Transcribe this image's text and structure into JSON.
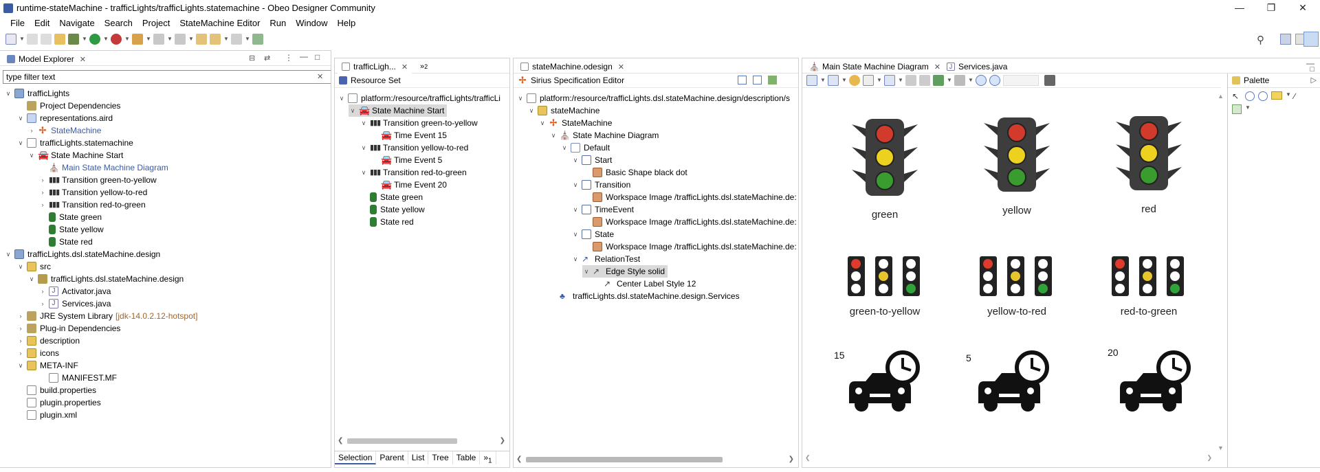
{
  "window": {
    "title": "runtime-stateMachine - trafficLights/trafficLights.statemachine - Obeo Designer Community"
  },
  "menu": [
    "File",
    "Edit",
    "Navigate",
    "Search",
    "Project",
    "StateMachine Editor",
    "Run",
    "Window",
    "Help"
  ],
  "model_explorer": {
    "tab_label": "Model Explorer",
    "filter_placeholder": "type filter text",
    "rows": [
      {
        "label": "trafficLights"
      },
      {
        "label": "Project Dependencies"
      },
      {
        "label": "representations.aird"
      },
      {
        "label": "StateMachine"
      },
      {
        "label": "trafficLights.statemachine"
      },
      {
        "label": "State Machine Start"
      },
      {
        "label": "Main State Machine Diagram"
      },
      {
        "label": "Transition green-to-yellow"
      },
      {
        "label": "Transition yellow-to-red"
      },
      {
        "label": "Transition red-to-green"
      },
      {
        "label": "State green"
      },
      {
        "label": "State yellow"
      },
      {
        "label": "State red"
      },
      {
        "label": "trafficLights.dsl.stateMachine.design"
      },
      {
        "label": "src"
      },
      {
        "label": "trafficLights.dsl.stateMachine.design"
      },
      {
        "label": "Activator.java"
      },
      {
        "label": "Services.java"
      },
      {
        "label": "JRE System Library"
      },
      {
        "label": "Plug-in Dependencies"
      },
      {
        "label": "description"
      },
      {
        "label": "icons"
      },
      {
        "label": "META-INF"
      },
      {
        "label": "MANIFEST.MF"
      },
      {
        "label": "build.properties"
      },
      {
        "label": "plugin.properties"
      },
      {
        "label": "plugin.xml"
      }
    ],
    "jre_version": "[jdk-14.0.2.12-hotspot]"
  },
  "resource_editor": {
    "tab_label": "trafficLigh...",
    "overflow_count": "2",
    "header": "Resource Set",
    "rows": [
      {
        "label": "platform:/resource/trafficLights/trafficLi"
      },
      {
        "label": "State Machine Start"
      },
      {
        "label": "Transition green-to-yellow"
      },
      {
        "label": "Time Event 15"
      },
      {
        "label": "Transition yellow-to-red"
      },
      {
        "label": "Time Event 5"
      },
      {
        "label": "Transition red-to-green"
      },
      {
        "label": "Time Event 20"
      },
      {
        "label": "State green"
      },
      {
        "label": "State yellow"
      },
      {
        "label": "State red"
      }
    ],
    "bottom_tabs": [
      "Selection",
      "Parent",
      "List",
      "Tree",
      "Table"
    ],
    "bottom_overflow": "1"
  },
  "odesign_editor": {
    "tab_label": "stateMachine.odesign",
    "header": "Sirius Specification Editor",
    "rows": [
      {
        "label": "platform:/resource/trafficLights.dsl.stateMachine.design/description/s"
      },
      {
        "label": "stateMachine"
      },
      {
        "label": "StateMachine"
      },
      {
        "label": "State Machine Diagram"
      },
      {
        "label": "Default"
      },
      {
        "label": "Start"
      },
      {
        "label": "Basic Shape black dot"
      },
      {
        "label": "Transition"
      },
      {
        "label": "Workspace Image /trafficLights.dsl.stateMachine.de:"
      },
      {
        "label": "TimeEvent"
      },
      {
        "label": "Workspace Image /trafficLights.dsl.stateMachine.de:"
      },
      {
        "label": "State"
      },
      {
        "label": "Workspace Image /trafficLights.dsl.stateMachine.de:"
      },
      {
        "label": "RelationTest"
      },
      {
        "label": "Edge Style solid"
      },
      {
        "label": "Center Label Style 12"
      },
      {
        "label": "trafficLights.dsl.stateMachine.design.Services"
      }
    ]
  },
  "diagram": {
    "tab_label": "Main State Machine Diagram",
    "tab2_label": "Services.java",
    "palette_label": "Palette",
    "states": [
      {
        "label": "green",
        "active": "green"
      },
      {
        "label": "yellow",
        "active": "yellow"
      },
      {
        "label": "red",
        "active": "red"
      }
    ],
    "transitions": [
      {
        "label": "green-to-yellow"
      },
      {
        "label": "yellow-to-red"
      },
      {
        "label": "red-to-green"
      }
    ],
    "time_events": [
      {
        "value": "15"
      },
      {
        "value": "5"
      },
      {
        "value": "20"
      }
    ]
  }
}
